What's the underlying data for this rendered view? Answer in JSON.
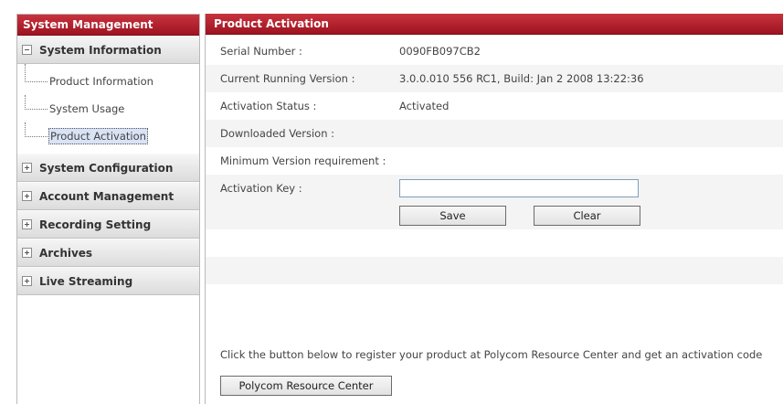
{
  "sidebar": {
    "title": "System Management",
    "sections": [
      {
        "label": "System Information",
        "expanded": true,
        "items": [
          {
            "label": "Product Information"
          },
          {
            "label": "System Usage"
          },
          {
            "label": "Product Activation",
            "selected": true
          }
        ]
      },
      {
        "label": "System Configuration",
        "expanded": false
      },
      {
        "label": "Account Management",
        "expanded": false
      },
      {
        "label": "Recording Setting",
        "expanded": false
      },
      {
        "label": "Archives",
        "expanded": false
      },
      {
        "label": "Live Streaming",
        "expanded": false
      }
    ]
  },
  "main": {
    "title": "Product Activation",
    "fields": [
      {
        "label": "Serial Number :",
        "value": "0090FB097CB2"
      },
      {
        "label": "Current Running Version :",
        "value": "3.0.0.010 556 RC1, Build: Jan 2 2008 13:22:36"
      },
      {
        "label": "Activation Status :",
        "value": "Activated"
      },
      {
        "label": "Downloaded Version :",
        "value": ""
      },
      {
        "label": "Minimum Version requirement :",
        "value": ""
      },
      {
        "label": "Activation Key :",
        "value": ""
      }
    ],
    "save_label": "Save",
    "clear_label": "Clear",
    "register_note": "Click the button below to register your product at Polycom Resource Center and get an activation code",
    "polycom_button_label": "Polycom Resource Center"
  },
  "colors": {
    "header_red": "#b01e2b",
    "section_gray": "#e6e6e6",
    "selected_item": "#d9e3f5"
  }
}
